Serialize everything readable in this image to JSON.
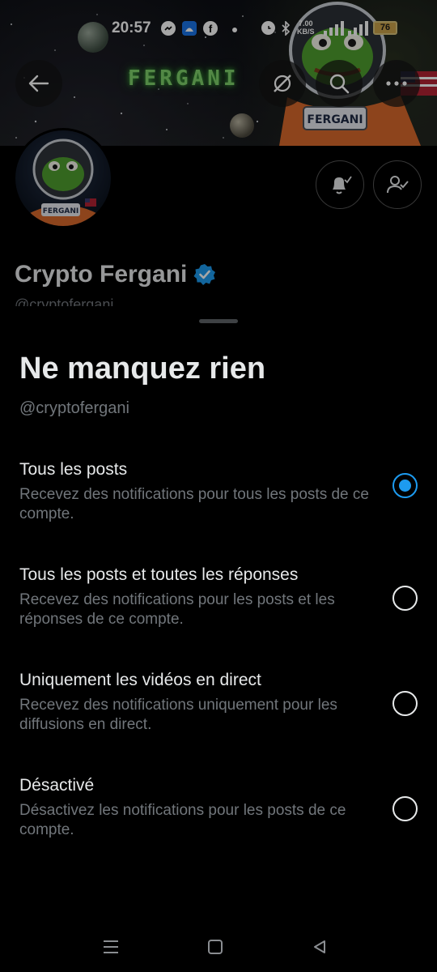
{
  "status_bar": {
    "time": "20:57",
    "net_speed": "7.00",
    "net_unit": "KB/S",
    "battery": "76",
    "icons": [
      "messenger-icon",
      "android-app-icon",
      "facebook-icon",
      "alarm-icon",
      "bluetooth-icon",
      "signal-icon",
      "wifi-icon",
      "battery-icon"
    ]
  },
  "banner": {
    "brand_text": "FERGANI",
    "accent_color": "#7fd16a"
  },
  "header": {
    "back_icon": "arrow-left-icon",
    "actions": [
      "grok-icon",
      "search-icon",
      "more-icon"
    ]
  },
  "profile": {
    "name": "Crypto Fergani",
    "handle": "@cryptofergani",
    "verified_color": "#1d9bf0",
    "actions": [
      "notification-bell-icon",
      "following-icon"
    ]
  },
  "sheet": {
    "title": "Ne manquez rien",
    "subtitle": "@cryptofergani",
    "selected_index": 0,
    "accent_color": "#1d9bf0",
    "options": [
      {
        "title": "Tous les posts",
        "description": "Recevez des notifications pour tous les posts de ce compte."
      },
      {
        "title": "Tous les posts et toutes les réponses",
        "description": "Recevez des notifications pour les posts et les réponses de ce compte."
      },
      {
        "title": "Uniquement les vidéos en direct",
        "description": "Recevez des notifications uniquement pour les diffusions en direct."
      },
      {
        "title": "Désactivé",
        "description": "Désactivez les notifications pour les posts de ce compte."
      }
    ]
  },
  "nav_bar": {
    "buttons": [
      "menu-icon",
      "home-icon",
      "back-icon"
    ]
  }
}
